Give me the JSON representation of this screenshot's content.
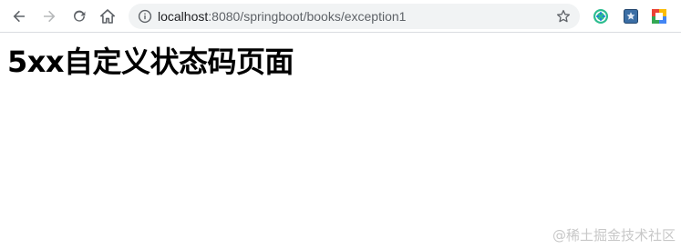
{
  "browser": {
    "address_bar": {
      "host": "localhost",
      "path": ":8080/springboot/books/exception1"
    },
    "icons": {
      "back": "back-arrow-icon",
      "forward": "forward-arrow-icon",
      "reload": "reload-icon",
      "home": "home-icon",
      "site_info": "info-icon",
      "bookmark": "star-icon",
      "extensions": [
        "green-sync-extension-icon",
        "blue-bookmark-extension-icon",
        "google-drive-extension-icon"
      ]
    }
  },
  "page": {
    "heading": "5xx自定义状态码页面"
  },
  "watermark": "@稀土掘金技术社区"
}
